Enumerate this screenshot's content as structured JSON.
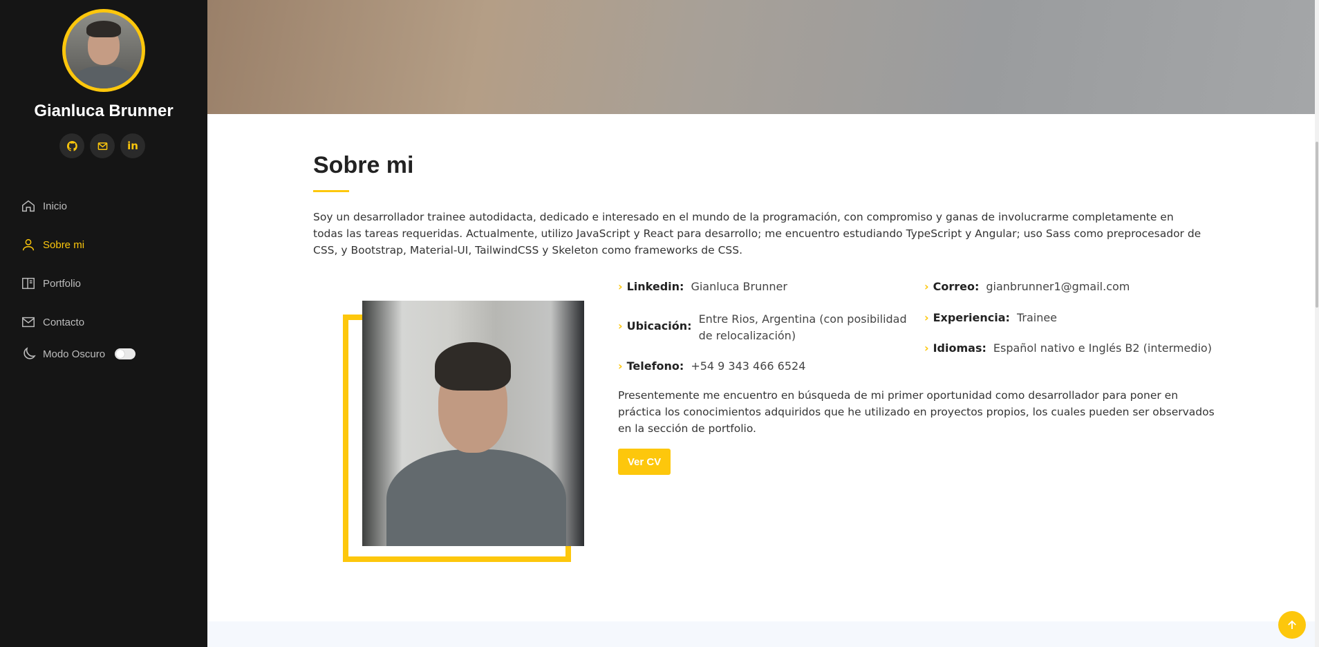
{
  "sidebar": {
    "name": "Gianluca Brunner",
    "socials": [
      {
        "icon": "github-icon",
        "glyph": "◉"
      },
      {
        "icon": "mail-icon",
        "glyph": "✉"
      },
      {
        "icon": "linkedin-icon",
        "glyph": "in"
      }
    ],
    "nav": [
      {
        "label": "Inicio",
        "icon": "home-icon",
        "active": false
      },
      {
        "label": "Sobre mi",
        "icon": "user-icon",
        "active": true
      },
      {
        "label": "Portfolio",
        "icon": "portfolio-icon",
        "active": false
      },
      {
        "label": "Contacto",
        "icon": "envelope-icon",
        "active": false
      }
    ],
    "dark_mode_label": "Modo Oscuro",
    "dark_mode_on": false
  },
  "about": {
    "title": "Sobre mi",
    "intro": "Soy un desarrollador trainee autodidacta, dedicado e interesado en el mundo de la programación, con compromiso y ganas de involucrarme completamente en todas las tareas requeridas. Actualmente, utilizo JavaScript y React para desarrollo; me encuentro estudiando TypeScript y Angular; uso Sass como preprocesador de CSS, y Bootstrap, Material-UI, TailwindCSS y Skeleton como frameworks de CSS.",
    "info_left": [
      {
        "label": "Linkedin:",
        "value": "Gianluca Brunner"
      },
      {
        "label": "Ubicación:",
        "value": "Entre Rios, Argentina (con posibilidad de relocalización)"
      },
      {
        "label": "Telefono:",
        "value": "+54 9 343 466 6524"
      }
    ],
    "info_right": [
      {
        "label": "Correo:",
        "value": "gianbrunner1@gmail.com"
      },
      {
        "label": "Experiencia:",
        "value": "Trainee"
      },
      {
        "label": "Idiomas:",
        "value": "Español nativo e Inglés B2 (intermedio)"
      }
    ],
    "description": "Presentemente me encuentro en búsqueda de mi primer oportunidad como desarrollador para poner en práctica los conocimientos adquiridos que he utilizado en proyectos propios, los cuales pueden ser observados en la sección de portfolio.",
    "cv_button": "Ver CV"
  },
  "colors": {
    "accent": "#fdc70c",
    "sidebar_bg": "#151515"
  }
}
